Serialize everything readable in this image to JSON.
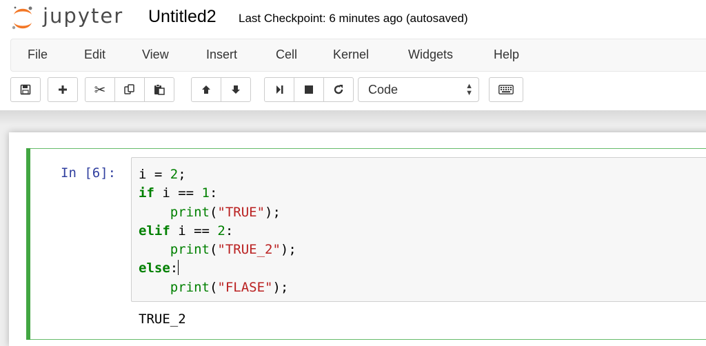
{
  "header": {
    "logo_text": "jupyter",
    "notebook_name": "Untitled2",
    "checkpoint": "Last Checkpoint: 6 minutes ago (autosaved)"
  },
  "menu": {
    "items": [
      "File",
      "Edit",
      "View",
      "Insert",
      "Cell",
      "Kernel",
      "Widgets",
      "Help"
    ]
  },
  "toolbar": {
    "buttons": [
      "save-icon",
      "plus-icon",
      "scissors-icon",
      "copy-icon",
      "paste-icon",
      "arrow-up-icon",
      "arrow-down-icon",
      "run-icon",
      "stop-icon",
      "restart-icon",
      "keyboard-icon"
    ],
    "cell_type": "Code"
  },
  "cell": {
    "prompt": "In [6]:",
    "code_lines": [
      "i = 2;",
      "if i == 1:",
      "    print(\"TRUE\");",
      "elif i == 2:",
      "    print(\"TRUE_2\");",
      "else:",
      "    print(\"FLASE\");"
    ],
    "output": "TRUE_2"
  },
  "colors": {
    "accent_green": "#42a642",
    "prompt_blue": "#303f9f",
    "string_red": "#ba2121",
    "keyword_green": "#008000",
    "logo_orange": "#f37726"
  }
}
